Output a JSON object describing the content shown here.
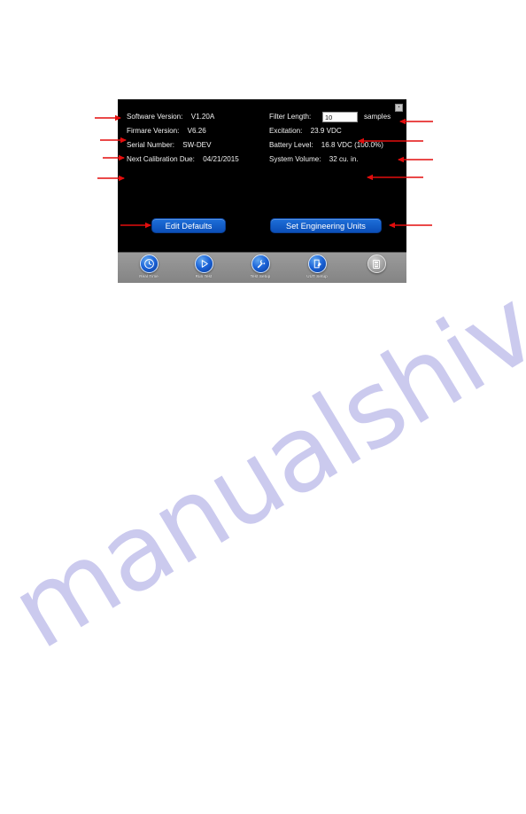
{
  "watermark": {
    "text": "manualshive.com"
  },
  "device": {
    "close_button": {
      "name": "close",
      "glyph": "▪"
    },
    "left_fields": [
      {
        "label": "Software Version:",
        "value": "V1.20A"
      },
      {
        "label": "Firmare Version:",
        "value": "V6.26"
      },
      {
        "label": "Serial Number:",
        "value": "SW-DEV"
      },
      {
        "label": "Next Calibration Due:",
        "value": "04/21/2015"
      }
    ],
    "filter_length": {
      "label": "Filter Length:",
      "value": "10",
      "placeholder": "10",
      "unit": "samples"
    },
    "right_fields": [
      {
        "label": "Excitation:",
        "value": "23.9  VDC"
      },
      {
        "label": "Battery Level:",
        "value": "16.8  VDC  (100.0%)"
      },
      {
        "label": "System Volume:",
        "value": "32 cu. in."
      }
    ],
    "buttons": {
      "edit_defaults": "Edit Defaults",
      "set_engineering_units": "Set Engineering Units"
    },
    "navbar": [
      {
        "label": "Real Time",
        "icon": "clock-icon",
        "enabled": true
      },
      {
        "label": "Run Test",
        "icon": "play-arrow-icon",
        "enabled": true
      },
      {
        "label": "Test Setup",
        "icon": "wrench-icon",
        "enabled": true
      },
      {
        "label": "UUT Setup",
        "icon": "page-edit-icon",
        "enabled": true
      },
      {
        "label": "",
        "icon": "database-icon",
        "enabled": false
      }
    ]
  },
  "colors": {
    "panel_bg": "#000000",
    "button_blue": "#1360c8",
    "navbar_gray": "#8e8e8e",
    "annotation_red": "#e30d0d",
    "watermark_purple": "#c9c8ee"
  }
}
